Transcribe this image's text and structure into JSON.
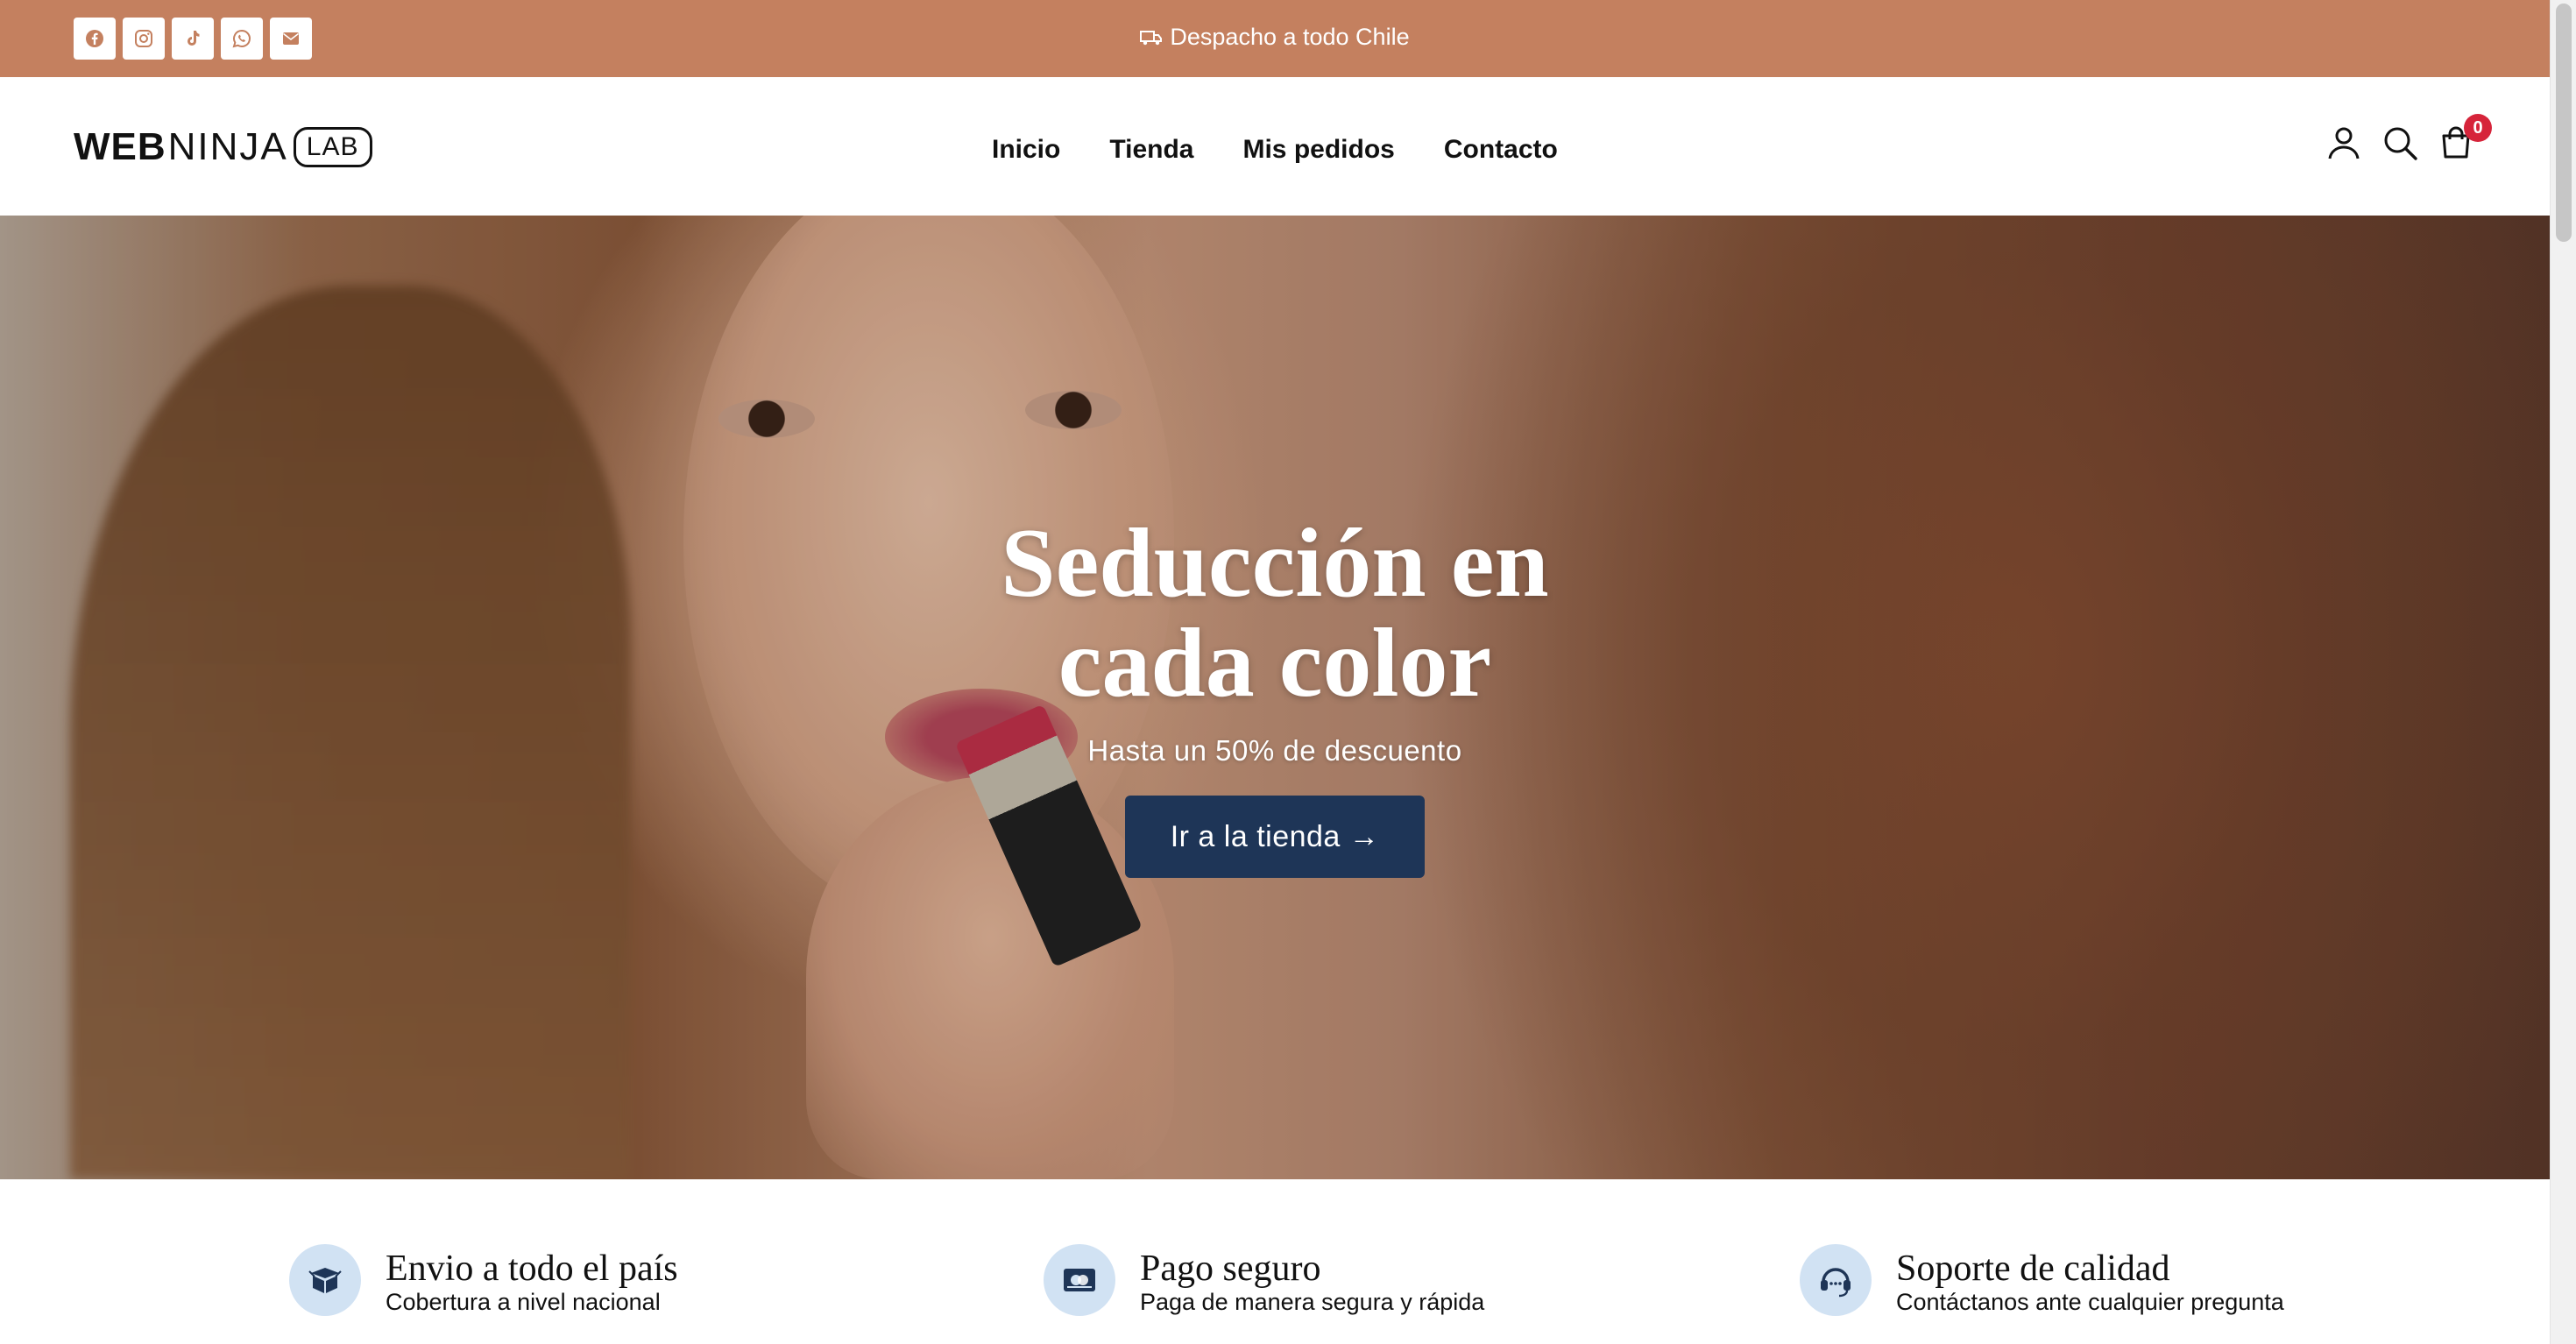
{
  "topbar": {
    "background_color": "#c4805f",
    "socials": [
      {
        "icon": "facebook-icon"
      },
      {
        "icon": "instagram-icon"
      },
      {
        "icon": "tiktok-icon"
      },
      {
        "icon": "whatsapp-icon"
      },
      {
        "icon": "email-icon"
      }
    ],
    "shipping_text": "Despacho a todo Chile"
  },
  "header": {
    "logo": {
      "part1": "WEB",
      "part2": "NINJA",
      "part3": "LAB"
    },
    "nav": [
      {
        "label": "Inicio"
      },
      {
        "label": "Tienda"
      },
      {
        "label": "Mis pedidos"
      },
      {
        "label": "Contacto"
      }
    ],
    "cart_count": "0",
    "icons": [
      "user-icon",
      "search-icon",
      "cart-icon"
    ]
  },
  "hero": {
    "title_line1": "Seducción en",
    "title_line2": "cada color",
    "subtitle": "Hasta un 50% de descuento",
    "button_label": "Ir a la tienda →",
    "button_color": "#1e3557"
  },
  "features": [
    {
      "icon": "box-icon",
      "title": "Envio a todo el país",
      "desc": "Cobertura a nivel nacional"
    },
    {
      "icon": "payment-card-icon",
      "title": "Pago seguro",
      "desc": "Paga de manera segura y rápida"
    },
    {
      "icon": "headset-icon",
      "title": "Soporte de calidad",
      "desc": "Contáctanos ante cualquier pregunta"
    }
  ],
  "colors": {
    "accent": "#c4805f",
    "badge": "#d6243a",
    "feature_icon_bg": "#d1e2f3"
  }
}
